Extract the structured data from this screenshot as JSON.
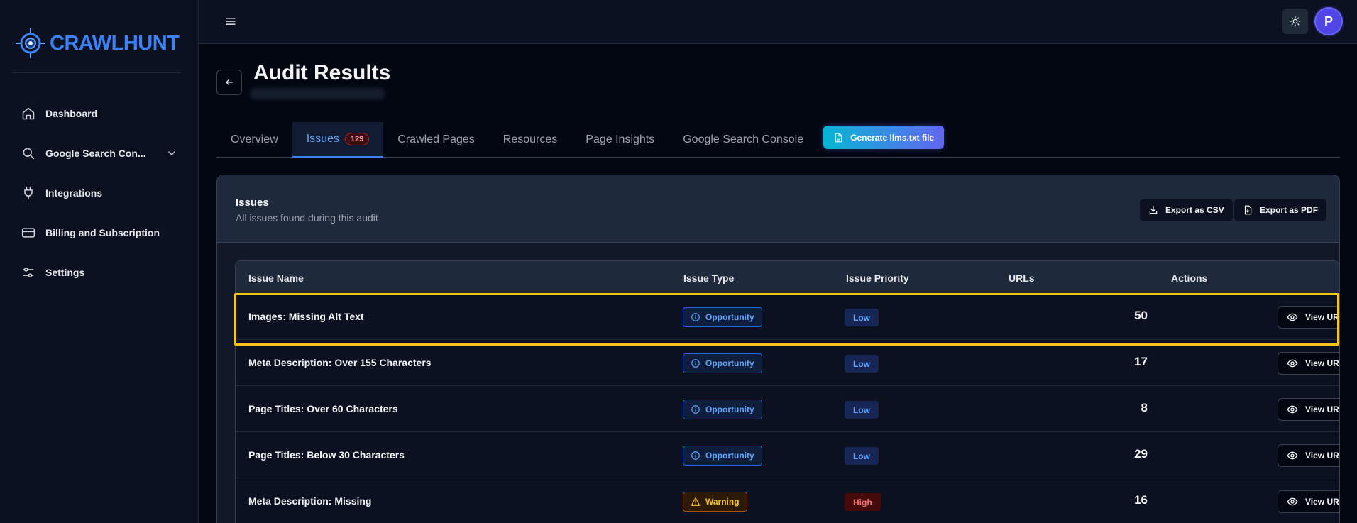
{
  "brand": {
    "name": "CRAWLHUNT"
  },
  "sidebar": {
    "items": [
      {
        "label": "Dashboard",
        "icon": "home-icon"
      },
      {
        "label": "Google Search Con...",
        "icon": "search-icon"
      },
      {
        "label": "Integrations",
        "icon": "plug-icon"
      },
      {
        "label": "Billing and Subscription",
        "icon": "credit-card-icon"
      },
      {
        "label": "Settings",
        "icon": "sliders-icon"
      }
    ]
  },
  "topbar": {
    "avatar_initial": "P"
  },
  "page": {
    "title": "Audit Results"
  },
  "tabs": {
    "overview": "Overview",
    "issues": "Issues",
    "issues_count": "129",
    "crawled": "Crawled Pages",
    "resources": "Resources",
    "insights": "Page Insights",
    "gsc": "Google Search Console",
    "generate": "Generate llms.txt file"
  },
  "card": {
    "title": "Issues",
    "subtitle": "All issues found during this audit",
    "export_csv": "Export as CSV",
    "export_pdf": "Export as PDF"
  },
  "table": {
    "headers": {
      "name": "Issue Name",
      "type": "Issue Type",
      "priority": "Issue Priority",
      "urls": "URLs",
      "actions": "Actions"
    },
    "rows": [
      {
        "name": "Images: Missing Alt Text",
        "type": "Opportunity",
        "priority": "Low",
        "urls": "50",
        "action": "View URLs"
      },
      {
        "name": "Meta Description: Over 155 Characters",
        "type": "Opportunity",
        "priority": "Low",
        "urls": "17",
        "action": "View URLs"
      },
      {
        "name": "Page Titles: Over 60 Characters",
        "type": "Opportunity",
        "priority": "Low",
        "urls": "8",
        "action": "View URLs"
      },
      {
        "name": "Page Titles: Below 30 Characters",
        "type": "Opportunity",
        "priority": "Low",
        "urls": "29",
        "action": "View URLs"
      },
      {
        "name": "Meta Description: Missing",
        "type": "Warning",
        "priority": "High",
        "urls": "16",
        "action": "View URLs"
      }
    ]
  },
  "colors": {
    "accent": "#3b82f6",
    "highlight": "#f5c518",
    "opportunity": "#60a5fa",
    "warning": "#fbbf24",
    "high": "#f87171"
  }
}
